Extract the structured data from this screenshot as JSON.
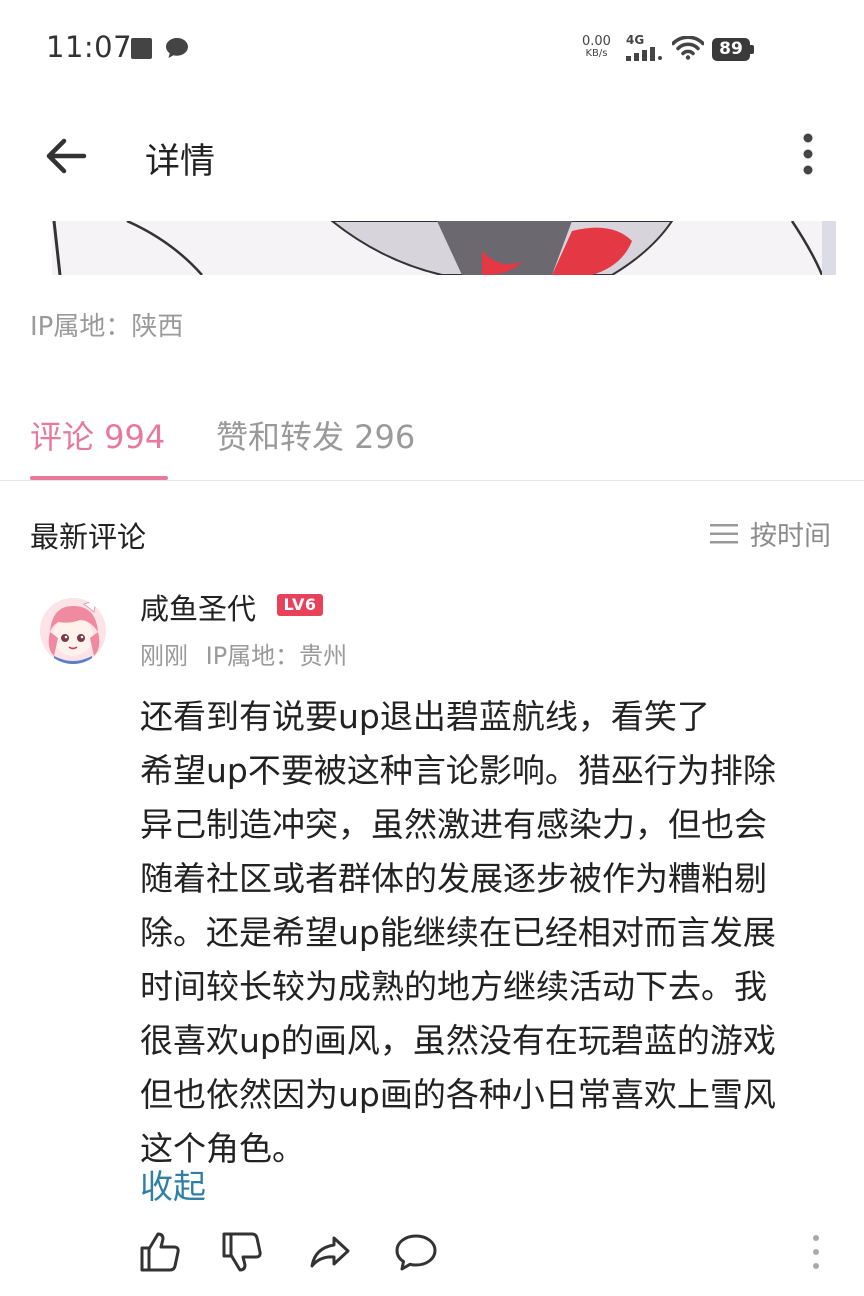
{
  "status_bar": {
    "time": "11:07",
    "net_speed_value": "0.00",
    "net_speed_unit": "KB/s",
    "network": "4G",
    "battery": "89"
  },
  "nav": {
    "title": "详情"
  },
  "post": {
    "ip_location": "IP属地：陕西"
  },
  "tabs": [
    {
      "label": "评论 994",
      "active": true
    },
    {
      "label": "赞和转发 296",
      "active": false
    }
  ],
  "comments_section": {
    "title": "最新评论",
    "sort_label": "按时间"
  },
  "comment": {
    "username": "咸鱼圣代",
    "level": "LV6",
    "meta": "刚刚 IP属地：贵州",
    "lines": [
      "还看到有说要up退出碧蓝航线，看笑了",
      "希望up不要被这种言论影响。猎巫行为排除",
      "异己制造冲突，虽然激进有感染力，但也会",
      "随着社区或者群体的发展逐步被作为糟粕剔",
      "除。还是希望up能继续在已经相对而言发展",
      "时间较长较为成熟的地方继续活动下去。我",
      "很喜欢up的画风，虽然没有在玩碧蓝的游戏",
      "但也依然因为up画的各种小日常喜欢上雪风",
      "这个角色。"
    ],
    "collapse_label": "收起"
  },
  "colors": {
    "accent": "#e8799a",
    "link": "#2f7fa6",
    "level_badge": "#e8425b"
  }
}
